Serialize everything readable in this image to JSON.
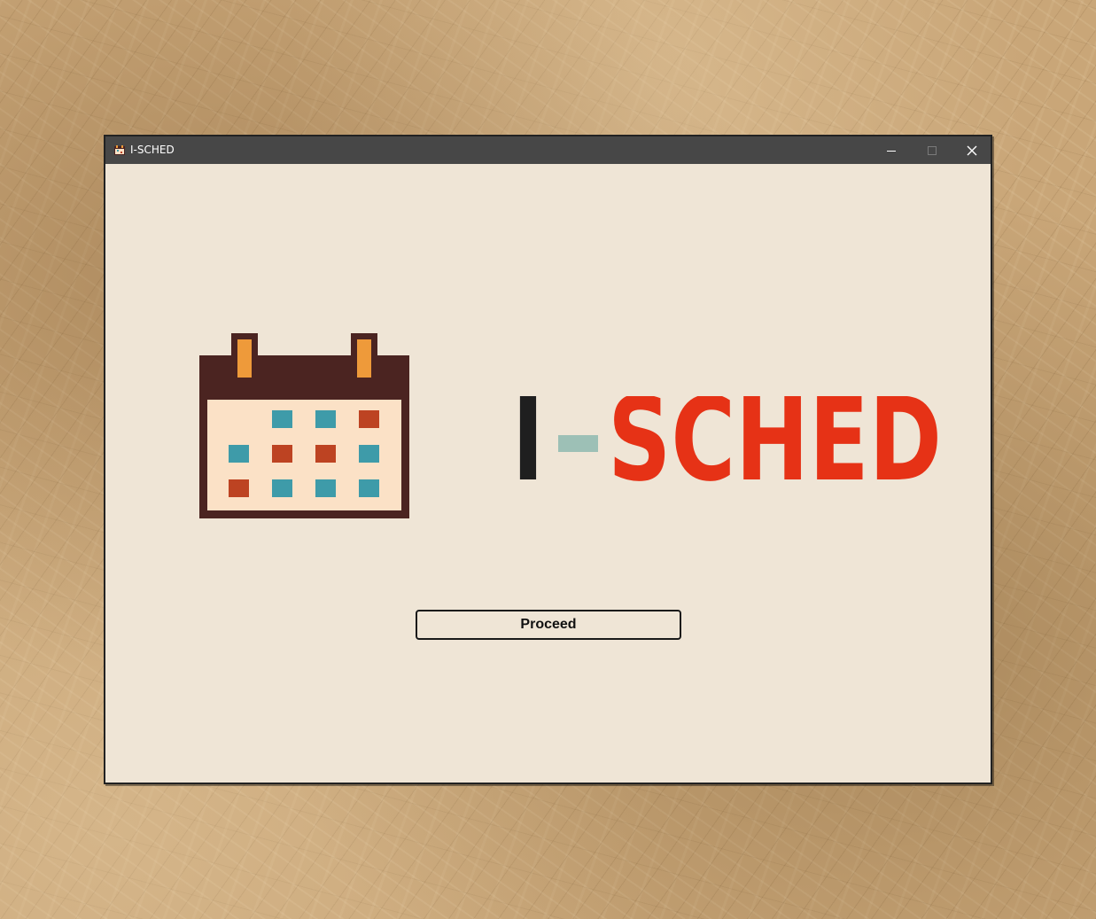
{
  "window": {
    "title": "I-SCHED",
    "minimize_icon": "minimize-icon",
    "maximize_icon": "maximize-icon",
    "close_icon": "close-icon"
  },
  "logo": {
    "prefix": "I",
    "hyphen": "-",
    "name": "SCHED",
    "icon": "calendar-icon",
    "colors": {
      "frame": "#4b2421",
      "rings": "#ee9a3a",
      "page": "#fbe1c6",
      "teal": "#3e9ba9",
      "rust": "#bd4322",
      "letter_i": "#1f1f1f",
      "hyphen": "#9dc0b6",
      "sched": "#e63216"
    }
  },
  "actions": {
    "proceed_label": "Proceed"
  },
  "theme": {
    "window_bg": "#efe5d6",
    "titlebar_bg": "#474747"
  }
}
